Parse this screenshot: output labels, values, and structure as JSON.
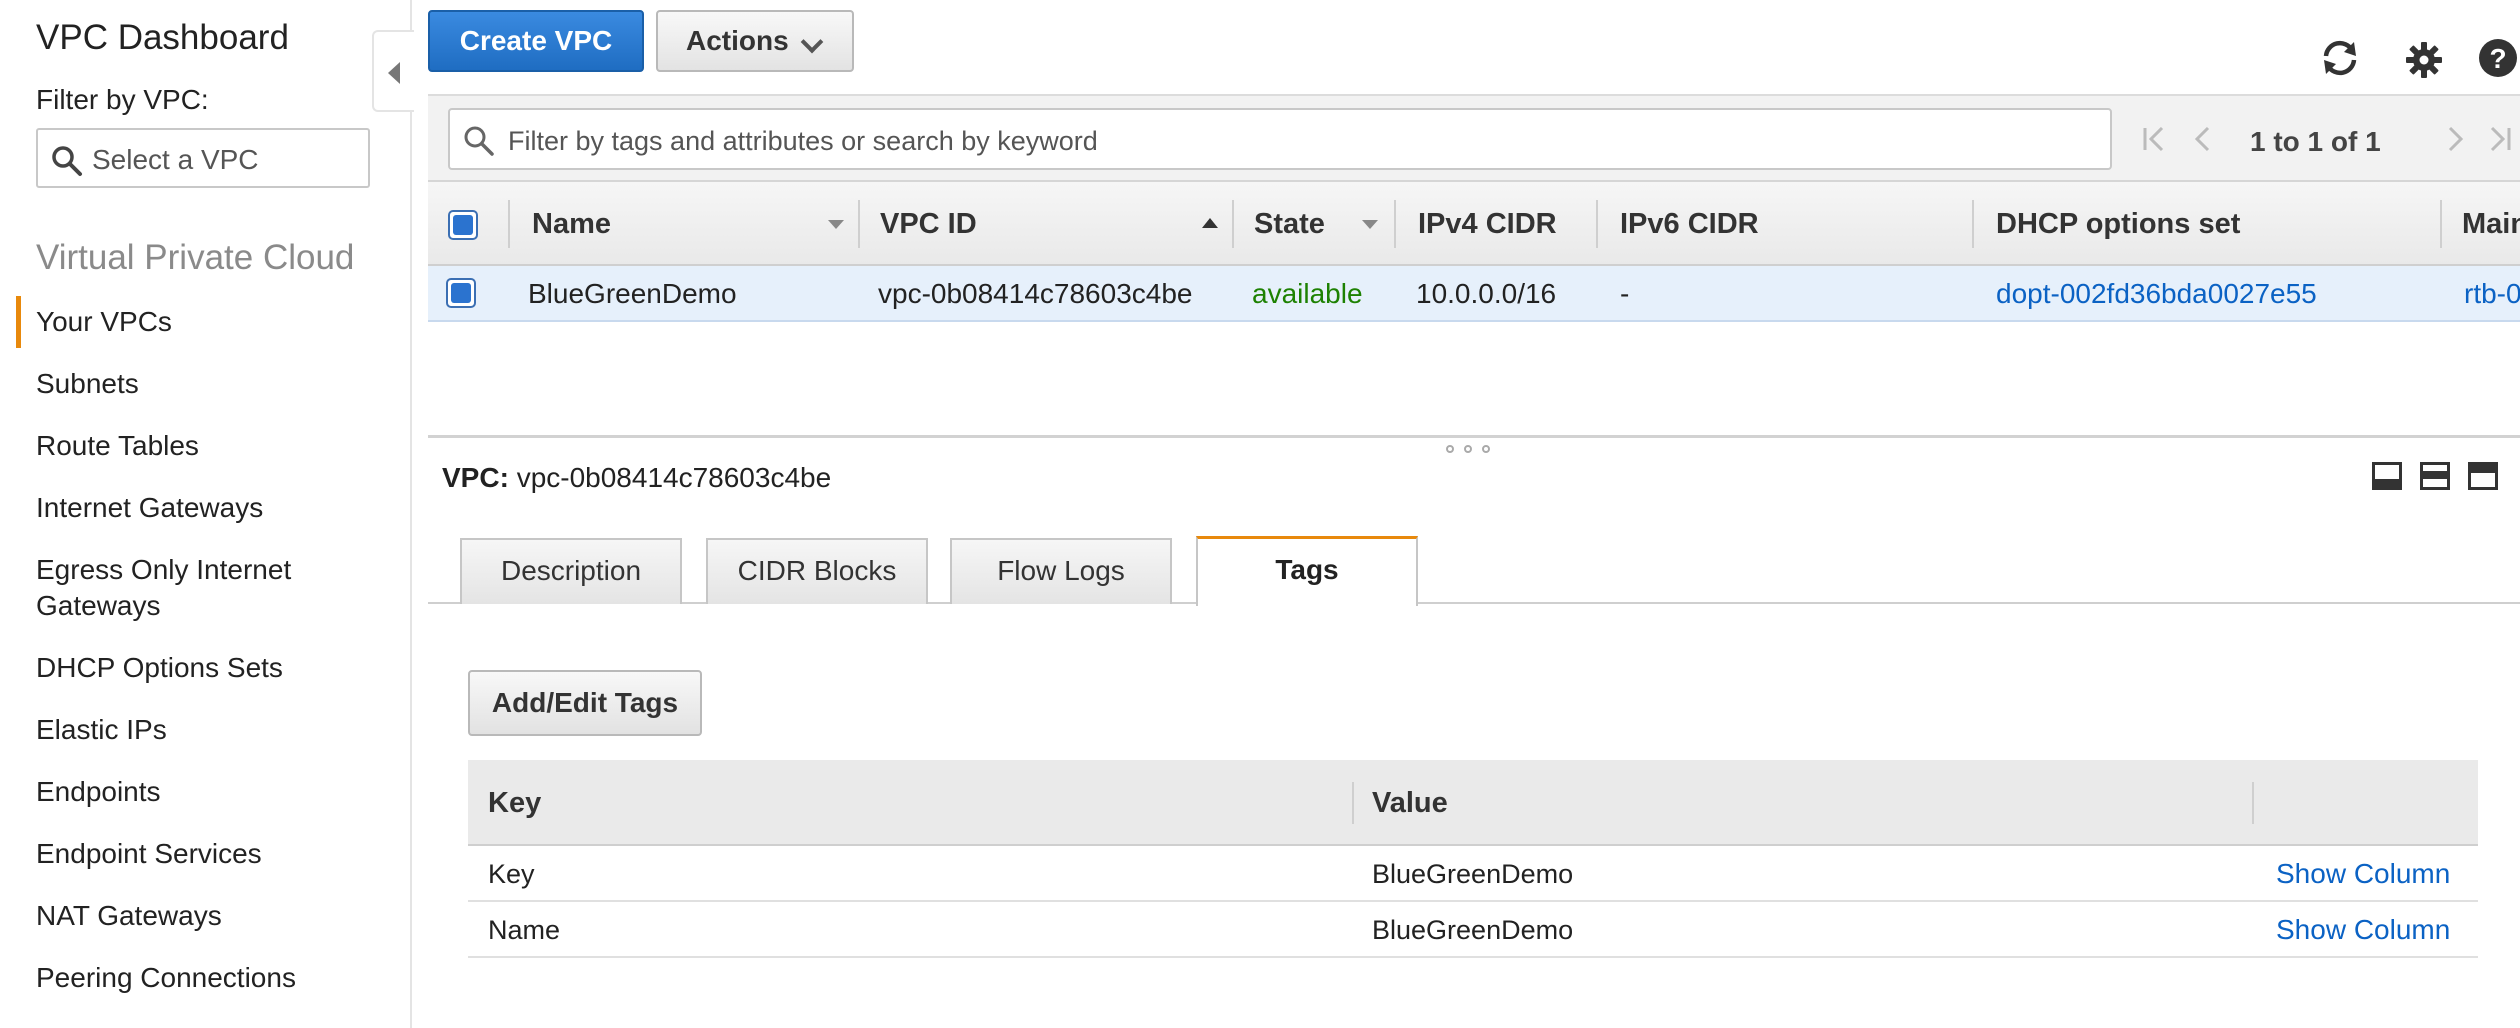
{
  "sidebar": {
    "title": "VPC Dashboard",
    "filter_label": "Filter by VPC:",
    "select_placeholder": "Select a VPC",
    "section_title": "Virtual Private Cloud",
    "items": [
      {
        "label": "Your VPCs",
        "active": true
      },
      {
        "label": "Subnets"
      },
      {
        "label": "Route Tables"
      },
      {
        "label": "Internet Gateways"
      },
      {
        "label": "Egress Only Internet Gateways"
      },
      {
        "label": "DHCP Options Sets"
      },
      {
        "label": "Elastic IPs"
      },
      {
        "label": "Endpoints"
      },
      {
        "label": "Endpoint Services"
      },
      {
        "label": "NAT Gateways"
      },
      {
        "label": "Peering Connections"
      }
    ]
  },
  "toolbar": {
    "create_label": "Create VPC",
    "actions_label": "Actions"
  },
  "search": {
    "placeholder": "Filter by tags and attributes or search by keyword"
  },
  "pager": {
    "text": "1 to 1 of 1"
  },
  "grid": {
    "columns": [
      "Name",
      "VPC ID",
      "State",
      "IPv4 CIDR",
      "IPv6 CIDR",
      "DHCP options set",
      "Main"
    ],
    "rows": [
      {
        "name": "BlueGreenDemo",
        "vpc_id": "vpc-0b08414c78603c4be",
        "state": "available",
        "ipv4": "10.0.0.0/16",
        "ipv6": "-",
        "dhcp": "dopt-002fd36bda0027e55",
        "main": "rtb-0"
      }
    ]
  },
  "details": {
    "label": "VPC:",
    "value": "vpc-0b08414c78603c4be",
    "tabs": [
      "Description",
      "CIDR Blocks",
      "Flow Logs",
      "Tags"
    ],
    "active_tab": "Tags",
    "add_edit_label": "Add/Edit Tags",
    "tag_columns": [
      "Key",
      "Value"
    ],
    "tags": [
      {
        "key": "Key",
        "value": "BlueGreenDemo",
        "action": "Show Column"
      },
      {
        "key": "Name",
        "value": "BlueGreenDemo",
        "action": "Show Column"
      }
    ]
  },
  "colors": {
    "primary": "#1f6dc2",
    "accent": "#e8890c",
    "status_available": "#1d8102",
    "link": "#0b62c4",
    "selected_row": "#e6f0fb"
  },
  "icons": {
    "refresh": "refresh-icon",
    "settings": "gear-icon",
    "help": "help-icon",
    "search": "search-icon"
  }
}
